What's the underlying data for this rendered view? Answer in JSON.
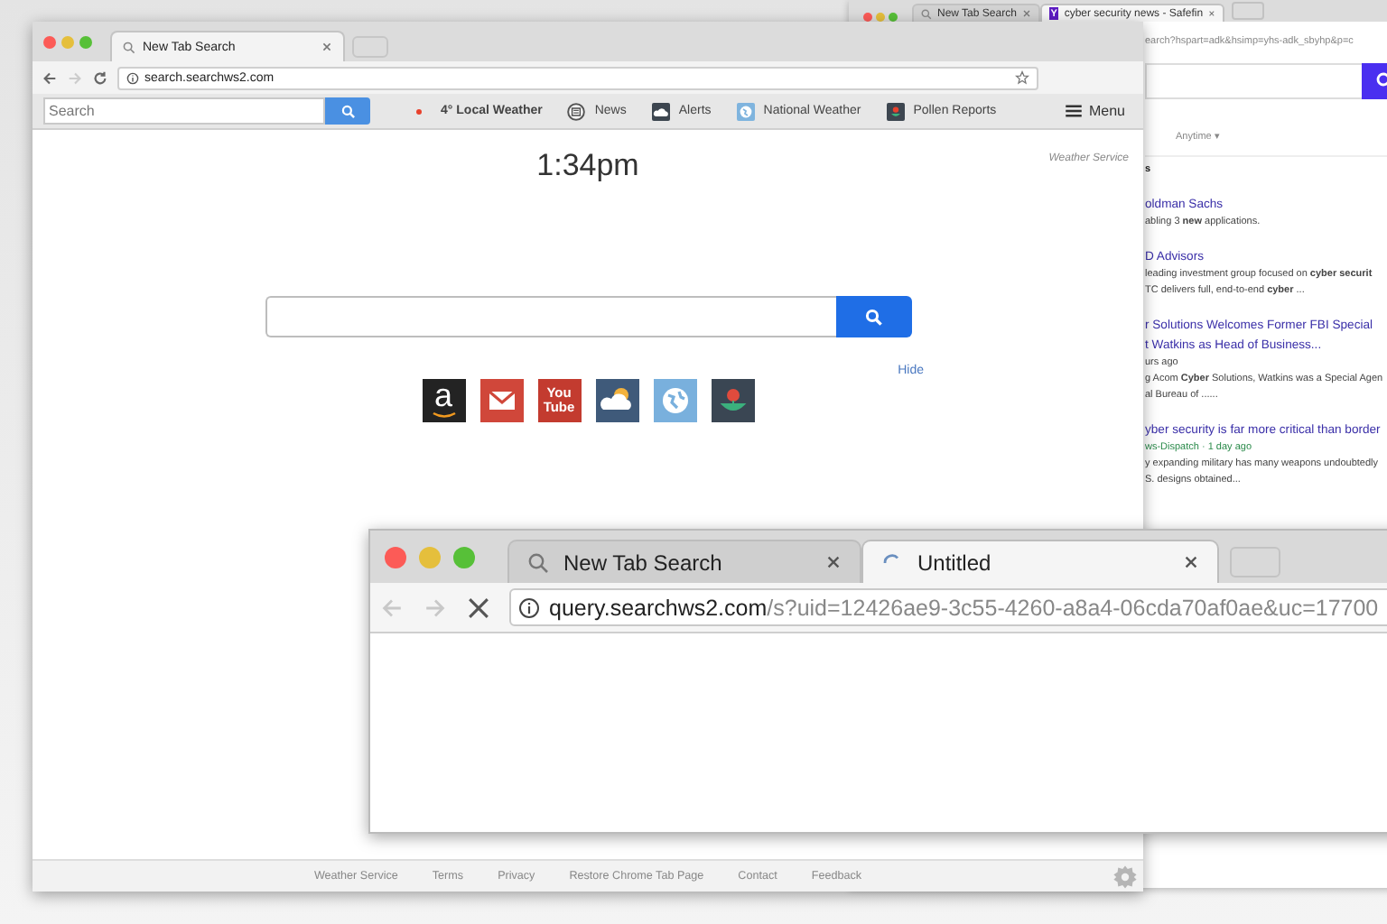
{
  "back_window": {
    "tabs": [
      {
        "label": "New Tab Search",
        "selected": false
      },
      {
        "label": "cyber security news - Safefin",
        "selected": true,
        "favicon": "Y"
      }
    ],
    "address": "earch?hspart=adk&hsimp=yhs-adk_sbyhp&p=c",
    "filter": "Anytime ▾",
    "results": [
      {
        "lines": [
          {
            "kind": "label",
            "text": "s"
          }
        ]
      },
      {
        "lines": [
          {
            "kind": "link",
            "text": "oldman Sachs"
          },
          {
            "kind": "snippet",
            "text": "abling 3 **new** applications."
          }
        ]
      },
      {
        "lines": [
          {
            "kind": "link",
            "text": "D Advisors"
          },
          {
            "kind": "snippet",
            "text": "leading investment group focused on **cyber securit**"
          },
          {
            "kind": "snippet",
            "text": "TC delivers full, end-to-end **cyber** ..."
          }
        ]
      },
      {
        "lines": [
          {
            "kind": "link",
            "text": "r Solutions Welcomes Former FBI Special"
          },
          {
            "kind": "link",
            "text": "t Watkins as Head of Business..."
          },
          {
            "kind": "snippet",
            "text": "urs ago"
          },
          {
            "kind": "snippet",
            "text": "g Acom **Cyber** Solutions, Watkins was a Special Agen"
          },
          {
            "kind": "snippet",
            "text": "al Bureau of ......"
          }
        ]
      },
      {
        "lines": [
          {
            "kind": "link",
            "text": "yber security is far more critical than border"
          },
          {
            "kind": "source",
            "text": "ws-Dispatch · 1 day ago"
          },
          {
            "kind": "snippet",
            "text": "y expanding military has many weapons undoubtedly"
          },
          {
            "kind": "snippet",
            "text": "S. designs obtained..."
          }
        ]
      }
    ]
  },
  "main_window": {
    "tabs": [
      {
        "label": "New Tab Search",
        "selected": true
      }
    ],
    "nav_buttons": [
      {
        "kind": "back",
        "disabled": false
      },
      {
        "kind": "forward",
        "disabled": true
      },
      {
        "kind": "reload",
        "disabled": false
      }
    ],
    "address": "search.searchws2.com",
    "toolbar_search": {
      "placeholder": "Search"
    },
    "nav_items": [
      {
        "kind": "weather",
        "label": "4° Local Weather"
      },
      {
        "kind": "news",
        "label": "News"
      },
      {
        "kind": "alerts",
        "label": "Alerts"
      },
      {
        "kind": "national",
        "label": "National Weather"
      },
      {
        "kind": "pollen",
        "label": "Pollen Reports"
      }
    ],
    "menu": "Menu",
    "time": "1:34pm",
    "weather_link": "Weather Service",
    "hide": "Hide",
    "shortcuts": [
      {
        "kind": "amazon",
        "label": "a"
      },
      {
        "kind": "mail"
      },
      {
        "kind": "youtube",
        "label": "You Tube"
      },
      {
        "kind": "weather"
      },
      {
        "kind": "globe"
      },
      {
        "kind": "flower"
      }
    ],
    "footer_links": [
      "Weather Service",
      "Terms",
      "Privacy",
      "Restore Chrome Tab Page",
      "Contact",
      "Feedback"
    ]
  },
  "front_window": {
    "tabs": [
      {
        "label": "New Tab Search",
        "selected": false,
        "loading": false
      },
      {
        "label": "Untitled",
        "selected": true,
        "loading": true
      }
    ],
    "nav_buttons": [
      {
        "kind": "back",
        "disabled": true
      },
      {
        "kind": "forward",
        "disabled": true
      },
      {
        "kind": "stop",
        "disabled": false
      }
    ],
    "address_host": "query.searchws2.com",
    "address_path": "/s?uid=12426ae9-3c55-4260-a8a4-06cda70af0ae&uc=17700"
  }
}
